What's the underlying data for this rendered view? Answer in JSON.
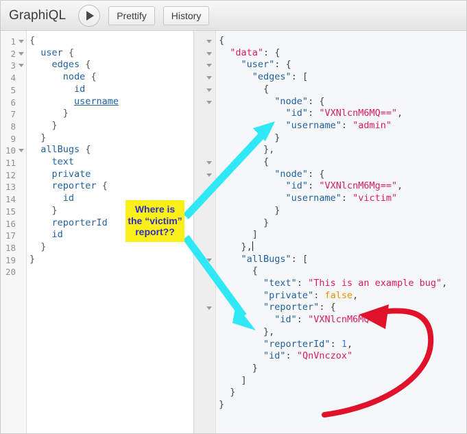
{
  "app": {
    "title": "GraphiQL"
  },
  "toolbar": {
    "execute_label": "execute-query",
    "prettify_label": "Prettify",
    "history_label": "History"
  },
  "query_editor": {
    "line_numbers": [
      "1",
      "2",
      "3",
      "4",
      "5",
      "6",
      "7",
      "8",
      "9",
      "10",
      "11",
      "12",
      "13",
      "14",
      "15",
      "16",
      "17",
      "18",
      "19",
      "20"
    ],
    "foldable_lines": [
      1,
      2,
      3,
      10
    ],
    "lines": [
      "{",
      "  user {",
      "    edges {",
      "      node {",
      "        id",
      "        username",
      "      }",
      "    }",
      "  }",
      "  allBugs {",
      "    text",
      "    private",
      "    reporter {",
      "      id",
      "    }",
      "    reporterId",
      "    id",
      "  }",
      "}",
      ""
    ],
    "hovered_field": "username"
  },
  "result_viewer": {
    "lines": [
      "{",
      "  \"data\": {",
      "    \"user\": {",
      "      \"edges\": [",
      "        {",
      "          \"node\": {",
      "            \"id\": \"VXNlcnM6MQ==\",",
      "            \"username\": \"admin\"",
      "          }",
      "        },",
      "        {",
      "          \"node\": {",
      "            \"id\": \"VXNlcnM6Mg==\",",
      "            \"username\": \"victim\"",
      "          }",
      "        }",
      "      ]",
      "    },",
      "    \"allBugs\": [",
      "      {",
      "        \"text\": \"This is an example bug\",",
      "        \"private\": false,",
      "        \"reporter\": {",
      "          \"id\": \"VXNlcnM6MQ==\"",
      "        },",
      "        \"reporterId\": 1,",
      "        \"id\": \"QnVnczox\"",
      "      }",
      "    ]",
      "  }",
      "}"
    ],
    "values": {
      "data_key": "data",
      "user_key": "user",
      "edges_key": "edges",
      "node_key": "node",
      "id_key": "id",
      "username_key": "username",
      "allbugs_key": "allBugs",
      "text_key": "text",
      "private_key": "private",
      "reporter_key": "reporter",
      "reporterid_key": "reporterId",
      "user1_id": "VXNlcnM6MQ==",
      "user1_username": "admin",
      "user2_id": "VXNlcnM6Mg==",
      "user2_username": "victim",
      "bug_text": "This is an example bug",
      "bug_private": "false",
      "bug_reporter_id": "VXNlcnM6MQ==",
      "bug_reporterid": "1",
      "bug_id": "QnVnczox"
    }
  },
  "annotations": {
    "callout_text": "Where is the “victim” report??",
    "callout_color": "#faf018",
    "callout_text_color": "#2f2fc0",
    "cyan_color": "#2fe8f5",
    "red_color": "#e0112b"
  }
}
